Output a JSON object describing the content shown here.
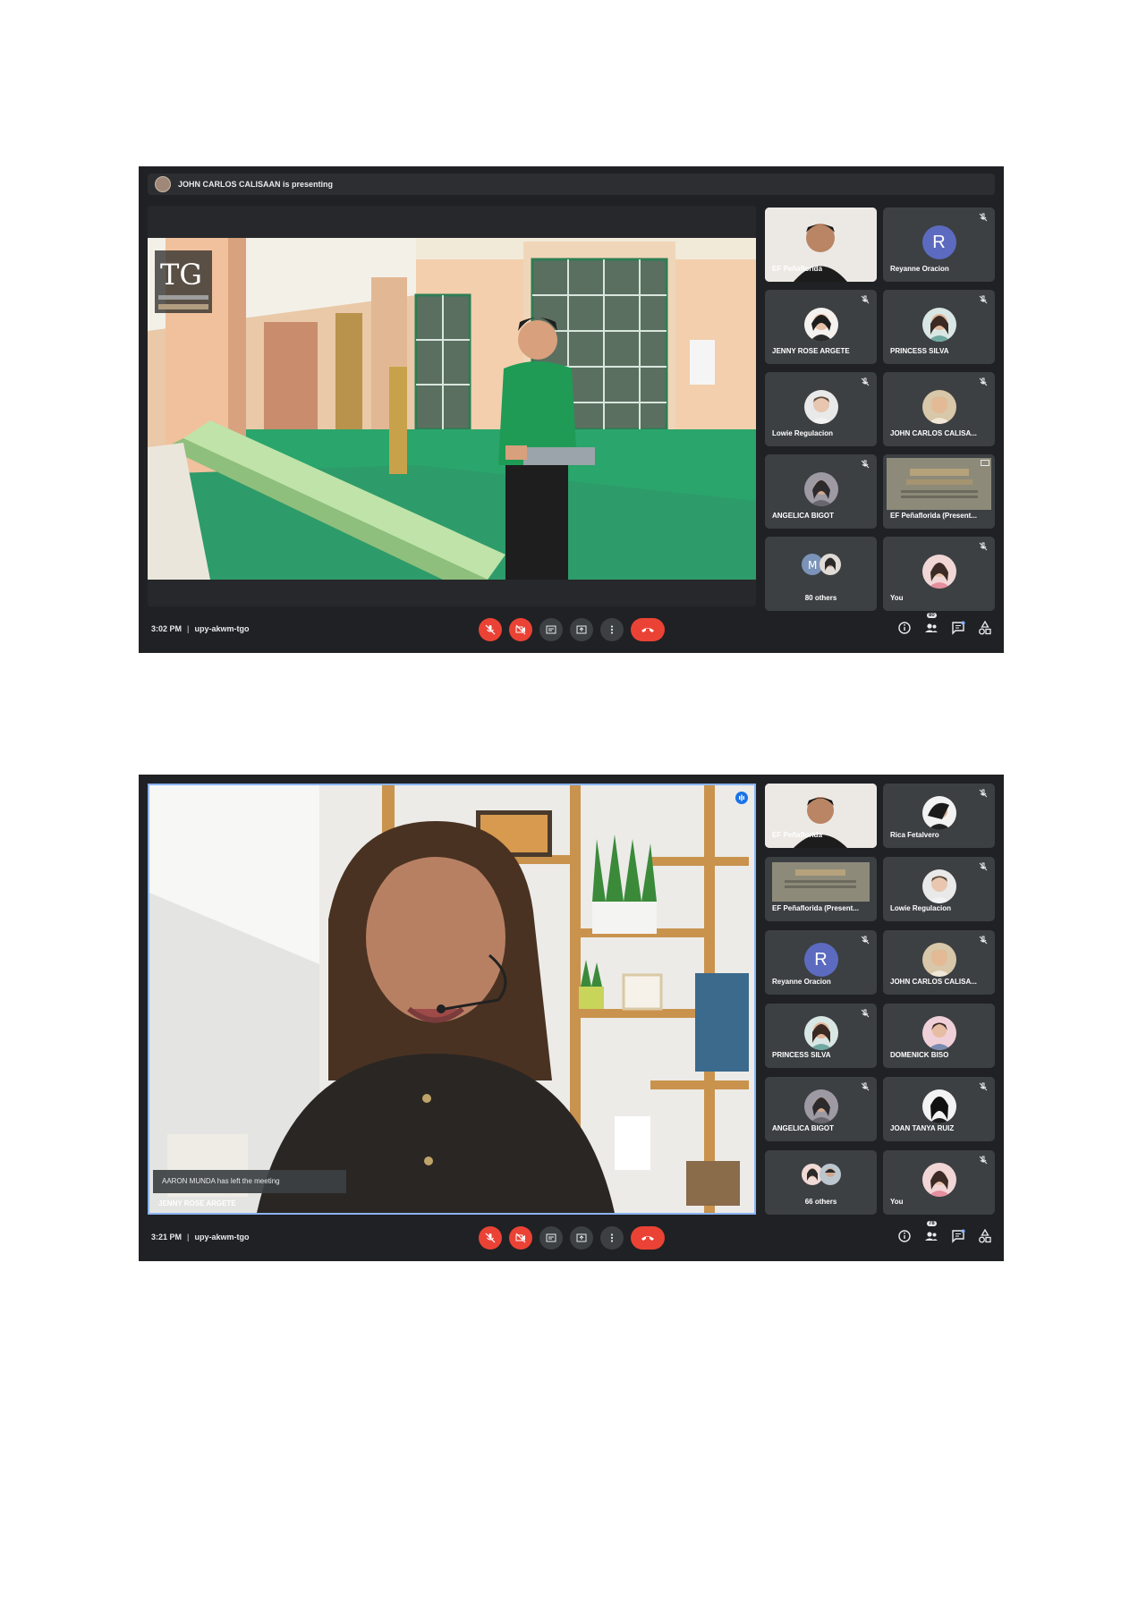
{
  "colors": {
    "window_bg": "#202124",
    "tile_bg": "#3c4043",
    "red_button": "#ea4335",
    "active_border": "#8ab4f8",
    "avatar_letter": "#5c6bc0"
  },
  "shot1": {
    "presenting_banner": "JOHN CARLOS CALISAAN is presenting",
    "logo_text": "TG",
    "tiles": [
      {
        "name": "EF Peñaflorida",
        "kind": "camera"
      },
      {
        "name": "Reyanne Oracion",
        "kind": "letter",
        "letter": "R"
      },
      {
        "name": "JENNY ROSE ARGETE",
        "kind": "photo"
      },
      {
        "name": "PRINCESS SILVA",
        "kind": "photo"
      },
      {
        "name": "Lowie Regulacion",
        "kind": "photo"
      },
      {
        "name": "JOHN CARLOS CALISA...",
        "kind": "photo"
      },
      {
        "name": "ANGELICA BIGOT",
        "kind": "photo"
      },
      {
        "name": "EF Peñaflorida (Present...",
        "kind": "presentation"
      },
      {
        "name": "80 others",
        "kind": "others"
      },
      {
        "name": "You",
        "kind": "photo"
      }
    ],
    "time": "3:02 PM",
    "meeting_code": "upy-akwm-tgo",
    "people_count": "80"
  },
  "shot2": {
    "tiles": [
      {
        "name": "EF Peñaflorida",
        "kind": "camera"
      },
      {
        "name": "Rica Fetalvero",
        "kind": "photo"
      },
      {
        "name": "EF Peñaflorida (Present...",
        "kind": "presentation"
      },
      {
        "name": "Lowie Regulacion",
        "kind": "photo"
      },
      {
        "name": "Reyanne Oracion",
        "kind": "letter",
        "letter": "R"
      },
      {
        "name": "JOHN CARLOS CALISA...",
        "kind": "photo"
      },
      {
        "name": "PRINCESS SILVA",
        "kind": "photo"
      },
      {
        "name": "DOMENICK BISO",
        "kind": "photo"
      },
      {
        "name": "ANGELICA BIGOT",
        "kind": "photo"
      },
      {
        "name": "JOAN TANYA RUIZ",
        "kind": "photo"
      },
      {
        "name": "66 others",
        "kind": "others"
      },
      {
        "name": "You",
        "kind": "photo"
      }
    ],
    "toast": "AARON MUNDA has left the meeting",
    "speaker_name": "JENNY ROSE ARGETE",
    "time": "3:21 PM",
    "meeting_code": "upy-akwm-tgo",
    "people_count": "78"
  }
}
